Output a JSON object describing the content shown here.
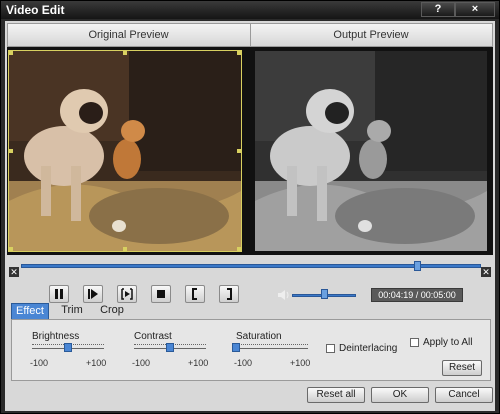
{
  "window": {
    "title": "Video Edit",
    "help_label": "?",
    "close_label": "×"
  },
  "preview": {
    "original_label": "Original Preview",
    "output_label": "Output Preview"
  },
  "playback": {
    "time_display": "00:04:19 / 00:05:00",
    "seek_fraction": 0.86,
    "volume_fraction": 0.5,
    "cut_left_label": "✕",
    "cut_right_label": "✕"
  },
  "tabs": [
    {
      "label": "Effect",
      "active": true
    },
    {
      "label": "Trim",
      "active": false
    },
    {
      "label": "Crop",
      "active": false
    }
  ],
  "effect": {
    "brightness": {
      "label": "Brightness",
      "min_label": "-100",
      "max_label": "+100",
      "value": 0
    },
    "contrast": {
      "label": "Contrast",
      "min_label": "-100",
      "max_label": "+100",
      "value": 0
    },
    "saturation": {
      "label": "Saturation",
      "min_label": "-100",
      "max_label": "+100",
      "value": -100
    },
    "deinterlacing_label": "Deinterlacing",
    "deinterlacing_checked": false,
    "apply_to_all_label": "Apply to All",
    "apply_to_all_checked": false,
    "reset_label": "Reset"
  },
  "footer": {
    "reset_all_label": "Reset all",
    "ok_label": "OK",
    "cancel_label": "Cancel"
  },
  "colors": {
    "accent": "#4a86d4",
    "seek": "#3a78c8",
    "title_bar": "#1a1a1a"
  }
}
